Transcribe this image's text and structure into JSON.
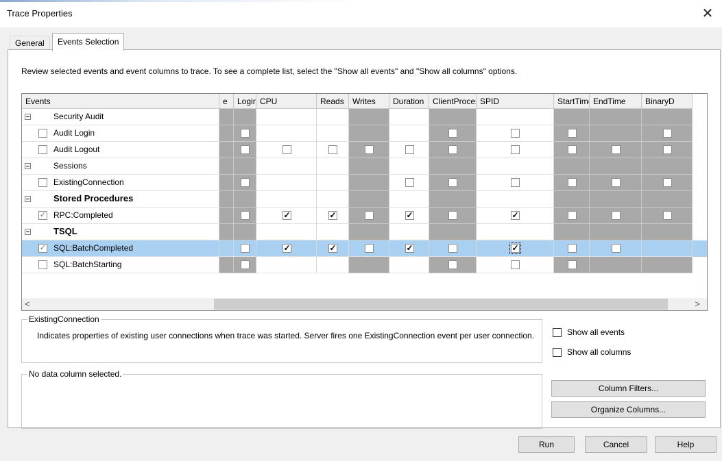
{
  "window": {
    "title": "Trace Properties",
    "close_glyph": "✕"
  },
  "tabs": [
    {
      "label": "General"
    },
    {
      "label": "Events Selection"
    }
  ],
  "instructions": "Review selected events and event columns to trace. To see a complete list, select the \"Show all events\" and \"Show all columns\" options.",
  "grid": {
    "events_header": "Events",
    "columns": [
      "e",
      "LoginName",
      "CPU",
      "Reads",
      "Writes",
      "Duration",
      "ClientProcessID",
      "SPID",
      "StartTime",
      "EndTime",
      "BinaryD"
    ],
    "rows": [
      {
        "kind": "category",
        "label": "Security Audit",
        "bold": false,
        "cells": [
          "g",
          "g",
          "w",
          "w",
          "g",
          "w",
          "g",
          "w",
          "g",
          "g",
          "g"
        ]
      },
      {
        "kind": "event",
        "label": "Audit Login",
        "checked": false,
        "selected": false,
        "cells": [
          "g",
          "gc",
          "w",
          "w",
          "g",
          "w",
          "gc",
          "wc",
          "gc",
          "g",
          "gc"
        ]
      },
      {
        "kind": "event",
        "label": "Audit Logout",
        "checked": false,
        "selected": false,
        "cells": [
          "g",
          "gc",
          "wc",
          "wc",
          "gc",
          "wc",
          "gc",
          "wc",
          "gc",
          "gc",
          "gc"
        ]
      },
      {
        "kind": "category",
        "label": "Sessions",
        "bold": false,
        "cells": [
          "g",
          "g",
          "w",
          "w",
          "g",
          "w",
          "g",
          "w",
          "g",
          "g",
          "g"
        ]
      },
      {
        "kind": "event",
        "label": "ExistingConnection",
        "checked": false,
        "selected": false,
        "cells": [
          "g",
          "gc",
          "w",
          "w",
          "g",
          "wc",
          "gc",
          "wc",
          "gc",
          "gc",
          "gc"
        ]
      },
      {
        "kind": "category",
        "label": "Stored Procedures",
        "bold": true,
        "cells": [
          "g",
          "g",
          "w",
          "w",
          "g",
          "w",
          "g",
          "w",
          "g",
          "g",
          "g"
        ]
      },
      {
        "kind": "event",
        "label": "RPC:Completed",
        "checked": true,
        "selected": false,
        "cells": [
          "g",
          "gc",
          "wx",
          "wx",
          "gc",
          "wx",
          "gc",
          "wx",
          "gc",
          "gc",
          "gc"
        ]
      },
      {
        "kind": "category",
        "label": "TSQL",
        "bold": true,
        "cells": [
          "g",
          "g",
          "w",
          "w",
          "g",
          "w",
          "g",
          "w",
          "g",
          "g",
          "g"
        ]
      },
      {
        "kind": "event",
        "label": "SQL:BatchCompleted",
        "checked": true,
        "selected": true,
        "cells": [
          "s",
          "sc",
          "sx",
          "sx",
          "sc",
          "sx",
          "sc",
          "sxf",
          "sc",
          "sc",
          "s"
        ]
      },
      {
        "kind": "event",
        "label": "SQL:BatchStarting",
        "checked": false,
        "selected": false,
        "cells": [
          "g",
          "gc",
          "w",
          "w",
          "g",
          "w",
          "gc",
          "wc",
          "gc",
          "g",
          "g"
        ]
      }
    ]
  },
  "scroll": {
    "left": "<",
    "right": ">"
  },
  "description_group": {
    "legend": "ExistingConnection",
    "text": "Indicates properties of existing user connections when trace was started.  Server fires one ExistingConnection event per user connection."
  },
  "column_group": {
    "legend": "No data column selected."
  },
  "options": {
    "show_all_events": "Show all events",
    "show_all_columns": "Show all columns"
  },
  "buttons": {
    "column_filters": "Column Filters...",
    "organize_columns": "Organize Columns...",
    "run": "Run",
    "cancel": "Cancel",
    "help": "Help"
  },
  "colors": {
    "gray_cell": "#a9a9a9",
    "selected_row": "#a9d0f0"
  }
}
